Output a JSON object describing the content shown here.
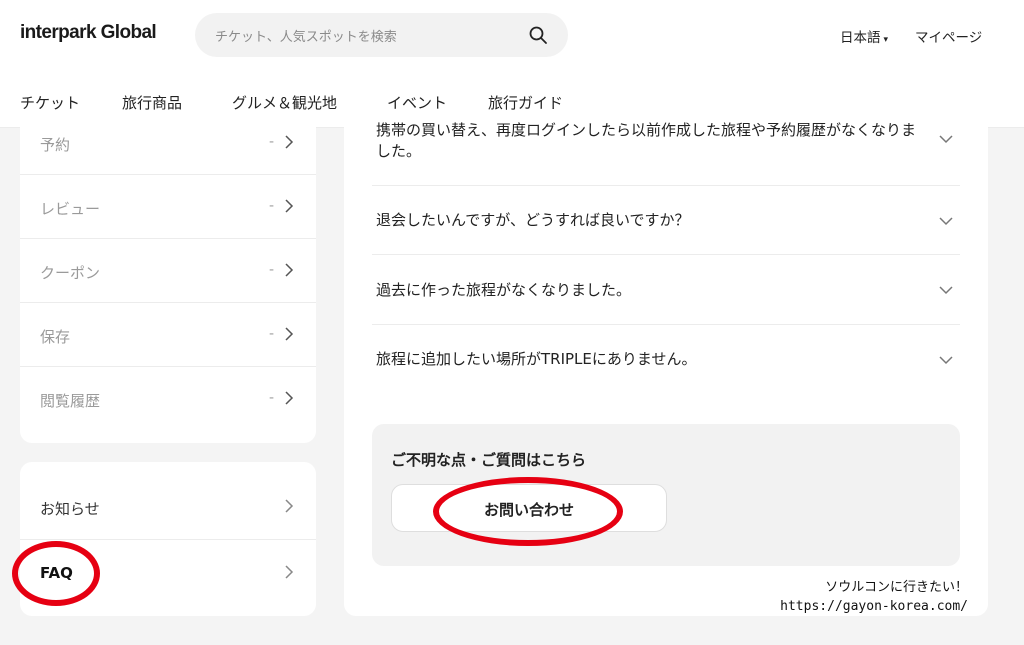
{
  "header": {
    "logo": "interpark Global",
    "search_placeholder": "チケット、人気スポットを検索",
    "language": "日本語",
    "language_caret": "▾",
    "mypage": "マイページ"
  },
  "nav": [
    "チケット",
    "旅行商品",
    "グルメ＆観光地",
    "イベント",
    "旅行ガイド"
  ],
  "sidebar": {
    "activity_items": [
      {
        "label": "予約",
        "value": "-"
      },
      {
        "label": "レビュー",
        "value": "-"
      },
      {
        "label": "クーポン",
        "value": "-"
      },
      {
        "label": "保存",
        "value": "-"
      },
      {
        "label": "閲覧履歴",
        "value": "-"
      }
    ],
    "support_items": [
      {
        "label": "お知らせ"
      },
      {
        "label": "FAQ"
      }
    ]
  },
  "faq": {
    "questions": [
      "携帯の買い替え、再度ログインしたら以前作成した旅程や予約履歴がなくなりました。",
      "退会したいんですが、どうすれば良いですか？",
      "過去に作った旅程がなくなりました。",
      "旅程に追加したい場所がTRIPLEにありません。"
    ]
  },
  "contact": {
    "title": "ご不明な点・ご質問はこちら",
    "button": "お問い合わせ"
  },
  "watermark": {
    "line1": "ソウルコンに行きたい！",
    "line2": "https://gayon-korea.com/"
  },
  "colors": {
    "highlight_ring": "#e60012"
  }
}
